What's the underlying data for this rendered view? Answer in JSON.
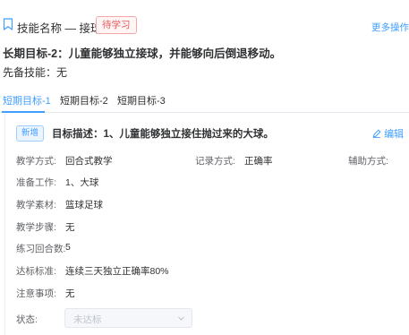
{
  "header": {
    "title": "技能名称 — 接球",
    "status_tag": "待学习",
    "more_ops": "更多操作"
  },
  "long_goal": "长期目标-2：儿童能够独立接球，并能够向后倒退移动。",
  "prereq": {
    "label": "先备技能：",
    "value": "无"
  },
  "tabs": [
    {
      "label": "短期目标-1",
      "active": true
    },
    {
      "label": "短期目标-2",
      "active": false
    },
    {
      "label": "短期目标-3",
      "active": false
    }
  ],
  "goal": {
    "badge": "新增",
    "description": "目标描述：1、儿童能够独立接住抛过来的大球。",
    "edit": "编辑"
  },
  "fields": {
    "teaching_method": {
      "label": "教学方式:",
      "value": "回合式教学"
    },
    "record_method": {
      "label": "记录方式:",
      "value": "正确率"
    },
    "assist_method": {
      "label": "辅助方式:"
    },
    "preparation": {
      "label": "准备工作:",
      "value": "1、大球"
    },
    "materials": {
      "label": "教学素材:",
      "value": "篮球足球"
    },
    "steps": {
      "label": "教学步骤:",
      "value": "无"
    },
    "rounds": {
      "label": "练习回合数:",
      "value": "5"
    },
    "standard": {
      "label": "达标标准:",
      "value": "连续三天独立正确率80%"
    },
    "notes": {
      "label": "注意事项:",
      "value": "无"
    },
    "status": {
      "label": "状态:",
      "value": "未达标"
    }
  },
  "colors": {
    "accent": "#409eff",
    "tag_red": "#e55b5b",
    "text": "#303133",
    "muted": "#606266"
  },
  "icons": [
    "bookmark-icon",
    "edit-icon",
    "chevron-down-icon"
  ]
}
